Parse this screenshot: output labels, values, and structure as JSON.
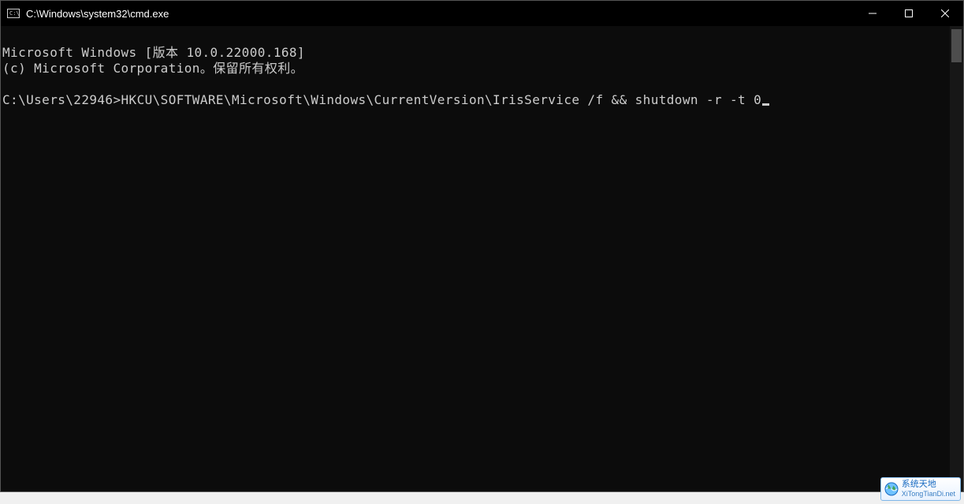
{
  "window": {
    "title": "C:\\Windows\\system32\\cmd.exe"
  },
  "terminal": {
    "line1": "Microsoft Windows [版本 10.0.22000.168]",
    "line2": "(c) Microsoft Corporation。保留所有权利。",
    "prompt": "C:\\Users\\22946>",
    "command": "HKCU\\SOFTWARE\\Microsoft\\Windows\\CurrentVersion\\IrisService /f && shutdown -r -t 0"
  },
  "watermark": {
    "primary": "系统天地",
    "secondary": "XiTongTianDi.net"
  }
}
